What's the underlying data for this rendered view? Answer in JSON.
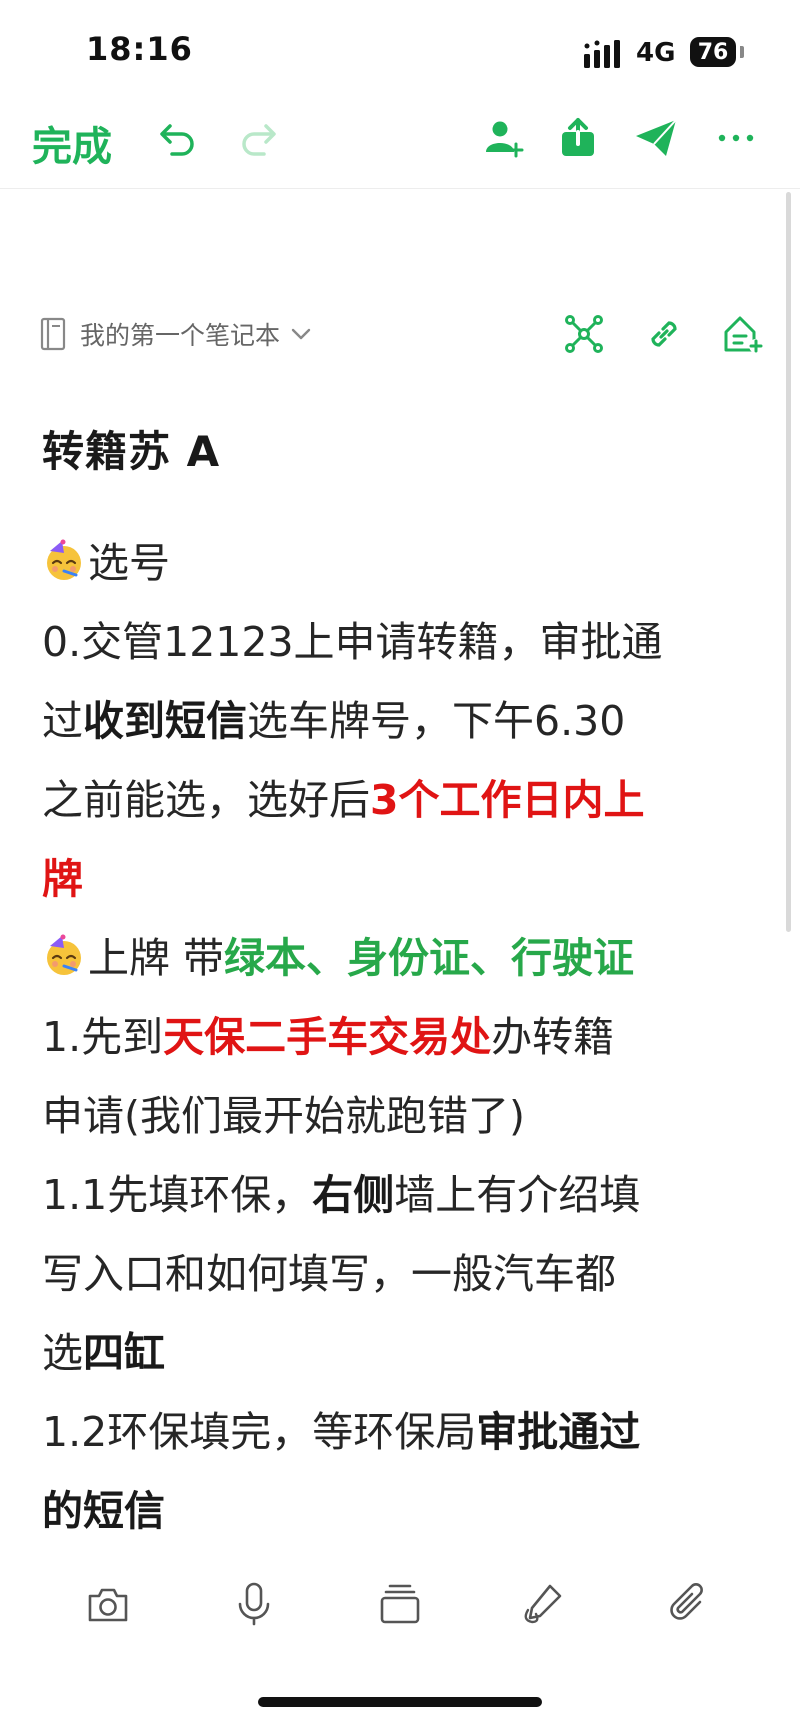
{
  "status_bar": {
    "time": "18:16",
    "network": "4G",
    "battery": "76"
  },
  "toolbar": {
    "done_label": "完成"
  },
  "notebook": {
    "name": "我的第一个笔记本"
  },
  "note": {
    "title": "转籍苏 A",
    "lines": [
      {
        "segments": [
          {
            "text": "选号"
          }
        ]
      },
      {
        "segments": [
          {
            "text": "0.交管12123上申请转籍，审批通"
          }
        ]
      },
      {
        "segments": [
          {
            "text": "过"
          },
          {
            "text": "收到短信"
          },
          {
            "text": "选车牌号，下午6.30"
          }
        ]
      },
      {
        "segments": [
          {
            "text": "之前能选，选好后"
          },
          {
            "text": "3个工作日内上"
          }
        ]
      },
      {
        "segments": [
          {
            "text": "牌"
          }
        ]
      },
      {
        "segments": [
          {
            "text": "上牌 带"
          },
          {
            "text": "绿本、身份证、行驶证"
          }
        ]
      },
      {
        "segments": [
          {
            "text": "1.先到"
          },
          {
            "text": "天保二手车交易处"
          },
          {
            "text": "办转籍"
          }
        ]
      },
      {
        "segments": [
          {
            "text": "申请(我们最开始就跑错了)"
          }
        ]
      },
      {
        "segments": [
          {
            "text": "1.1先填环保，"
          },
          {
            "text": "右侧"
          },
          {
            "text": "墙上有介绍填"
          }
        ]
      },
      {
        "segments": [
          {
            "text": "写入口和如何填写，一般汽车都"
          }
        ]
      },
      {
        "segments": [
          {
            "text": "选"
          },
          {
            "text": "四缸"
          }
        ]
      },
      {
        "segments": [
          {
            "text": "1.2环保填完，等环保局"
          },
          {
            "text": "审批通过"
          }
        ]
      },
      {
        "segments": [
          {
            "text": "的短信"
          }
        ]
      }
    ]
  },
  "colors": {
    "accent": "#1fb35a",
    "highlight_red": "#e01414",
    "highlight_green": "#27a84a"
  },
  "icons": {
    "toolbar": [
      "undo-icon",
      "redo-icon",
      "add-collaborator-icon",
      "share-icon",
      "send-icon",
      "more-icon"
    ],
    "notebook_row": [
      "notebook-icon",
      "chevron-down-icon",
      "mind-map-icon",
      "link-icon",
      "add-to-home-icon"
    ],
    "content": [
      "party-face-emoji"
    ],
    "bottom_bar": [
      "camera-icon",
      "microphone-icon",
      "card-stack-icon",
      "handwriting-icon",
      "attachment-icon"
    ]
  }
}
